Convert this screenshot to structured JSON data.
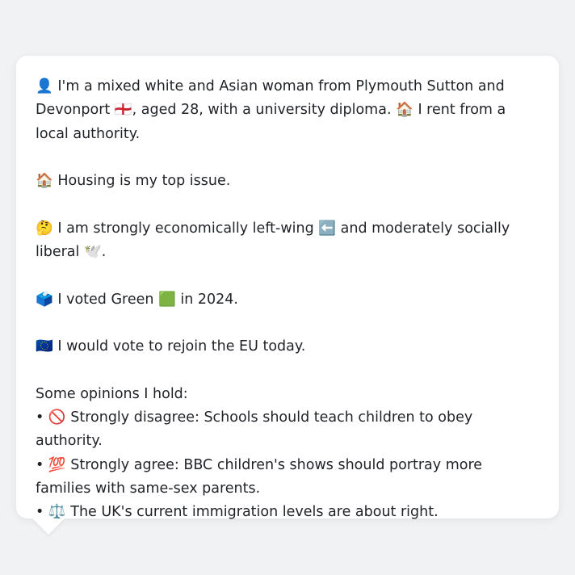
{
  "profile": {
    "intro_icon": "👤",
    "intro_text_1": " I'm a mixed white and Asian woman from Plymouth Sutton and Devonport ",
    "flag_icon": "🏴󠁧󠁢󠁥󠁮󠁧󠁿",
    "intro_text_2": ", aged 28, with a university diploma. ",
    "house_icon": "🏠",
    "intro_text_3": " I rent from a local authority.",
    "issue_icon": "🏠",
    "issue_text": " Housing is my top issue.",
    "think_icon": "🤔",
    "stance_text_1": " I am strongly economically left-wing ",
    "left_arrow_icon": "⬅️",
    "stance_text_2": " and moderately socially liberal ",
    "dove_icon": "🕊️",
    "stance_text_3": ".",
    "ballot_icon": "🗳️",
    "vote_text_1": " I voted Green ",
    "green_square_icon": "🟩",
    "vote_text_2": " in 2024.",
    "eu_icon": "🇪🇺",
    "eu_text": " I would vote to rejoin the EU today.",
    "opinions_heading": "Some opinions I hold:",
    "opinions": [
      {
        "bullet": "• ",
        "icon": "🚫",
        "text": " Strongly disagree: Schools should teach children to obey authority."
      },
      {
        "bullet": "• ",
        "icon": "💯",
        "text": " Strongly agree: BBC children's shows should portray more families with same-sex parents."
      },
      {
        "bullet": "• ",
        "icon": "⚖️",
        "text": " The UK's current immigration levels are about right."
      }
    ]
  },
  "colors": {
    "background": "#f1f2f4",
    "bubble": "#ffffff",
    "text": "#1f2328"
  }
}
